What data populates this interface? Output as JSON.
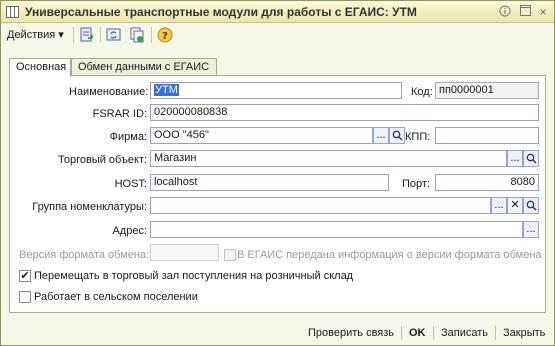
{
  "window": {
    "title": "Универсальные транспортные модули для работы с ЕГАИС: УТМ",
    "btn_close": "×"
  },
  "toolbar": {
    "actions_label": "Действия",
    "actions_arrow": "▾"
  },
  "tabs": [
    {
      "label": "Основная",
      "active": true
    },
    {
      "label": "Обмен данными с ЕГАИС",
      "active": false
    }
  ],
  "form": {
    "name_label": "Наименование:",
    "name_value": "УТМ",
    "code_label": "Код:",
    "code_value": "пп0000001",
    "fsrar_label": "FSRAR ID:",
    "fsrar_value": "020000080838",
    "firm_label": "Фирма:",
    "firm_value": "ООО \"456\"",
    "kpp_label": "КПП:",
    "kpp_value": "",
    "trade_obj_label": "Торговый объект:",
    "trade_obj_value": "Магазин",
    "host_label": "HOST:",
    "host_value": "localhost",
    "port_label": "Порт:",
    "port_value": "8080",
    "nomen_group_label": "Группа номенклатуры:",
    "nomen_group_value": "",
    "address_label": "Адрес:",
    "address_value": "",
    "format_version_label": "Версия формата обмена:",
    "format_version_value": "",
    "egais_info_label": "В ЕГАИС передана информация о версии формата обмена",
    "move_label": "Перемещать в торговый зал поступления на розничный склад",
    "move_checked": true,
    "rural_label": "Работает в сельском поселении",
    "rural_checked": false,
    "dots": "...",
    "clear": "✕",
    "check_mark": "✔"
  },
  "footer": {
    "check_connection": "Проверить связь",
    "ok": "OK",
    "save": "Записать",
    "close": "Закрыть"
  },
  "colors": {
    "window_bg": "#f5f8e6",
    "field_border": "#9aa3c7",
    "selection": "#3a6dd6"
  }
}
